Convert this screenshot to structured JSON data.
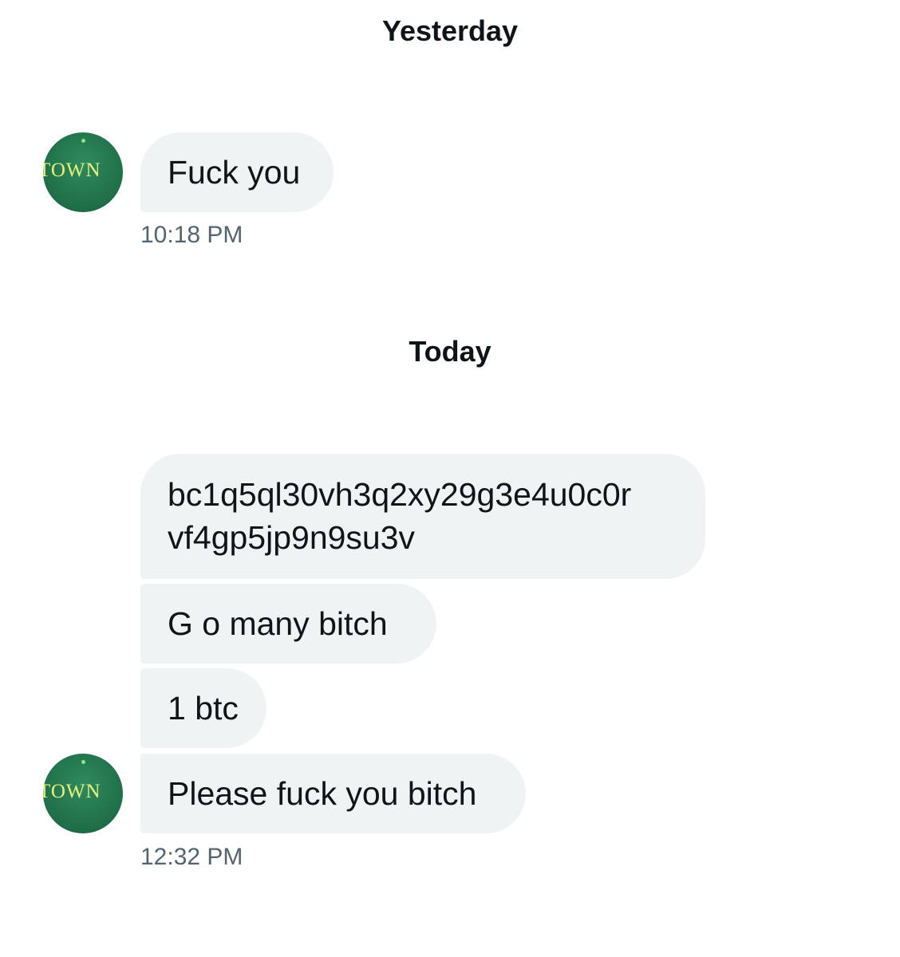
{
  "conversation": {
    "days": [
      {
        "label": "Yesterday",
        "messages": [
          {
            "lines": [
              "Fuck you"
            ]
          }
        ],
        "time": "10:18 PM"
      },
      {
        "label": "Today",
        "messages": [
          {
            "lines": [
              "bc1q5ql30vh3q2xy29g3e4u0c0r",
              "vf4gp5jp9n9su3v"
            ]
          },
          {
            "lines": [
              "G o many  bitch"
            ]
          },
          {
            "lines": [
              "1 btc"
            ]
          },
          {
            "lines": [
              "Please fuck you bitch"
            ]
          }
        ],
        "time": "12:32 PM"
      }
    ]
  },
  "avatar": {
    "logo_text": "TOWN",
    "icon": "green-circle-logo-avatar"
  },
  "colors": {
    "bubble_background": "#eff3f4",
    "text": "#0f1419",
    "timestamp": "#536471",
    "avatar_green": "#1f6e48",
    "avatar_logo": "#e8f27a"
  }
}
